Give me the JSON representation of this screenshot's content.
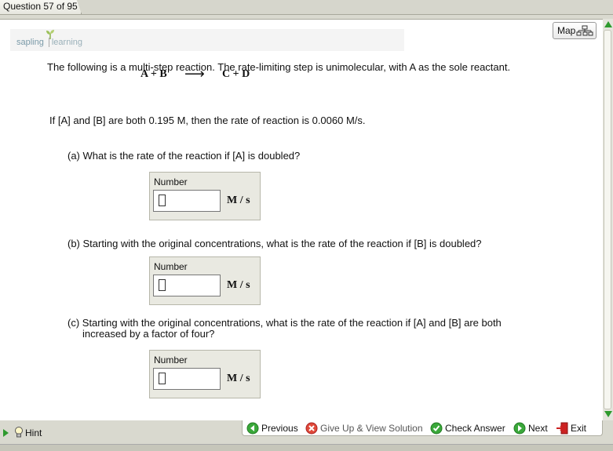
{
  "header": {
    "question_counter": "Question 57 of 95"
  },
  "logo": {
    "part1": "sapling",
    "part2": "learning"
  },
  "map_button": {
    "label": "Map"
  },
  "problem": {
    "intro": "The following is a multi-step reaction. The rate-limiting step is unimolecular, with A as the sole reactant.",
    "equation": {
      "reactants": "A + B",
      "arrow": "⟶",
      "products": "C + D"
    },
    "given": "If [A] and [B] are both 0.195 M, then the rate of reaction is 0.0060 M/s."
  },
  "parts": [
    {
      "question": "(a) What is the rate of the reaction if [A] is doubled?",
      "field_label": "Number",
      "value": "",
      "unit": "M / s"
    },
    {
      "question": "(b) Starting with the original concentrations, what is the rate of the reaction if [B] is doubled?",
      "field_label": "Number",
      "value": "",
      "unit": "M / s"
    },
    {
      "question_line1": "(c) Starting with the original concentrations, what is the rate of the reaction if [A] and [B] are both",
      "question_line2": "increased by a factor of four?",
      "field_label": "Number",
      "value": "",
      "unit": "M / s"
    }
  ],
  "hint": {
    "label": "Hint"
  },
  "nav": {
    "previous": "Previous",
    "give_up": "Give Up & View Solution",
    "check": "Check Answer",
    "next": "Next",
    "exit": "Exit"
  },
  "colors": {
    "accent_green": "#2e9a2e",
    "give_up_red": "#d33",
    "exit_red": "#c22"
  }
}
